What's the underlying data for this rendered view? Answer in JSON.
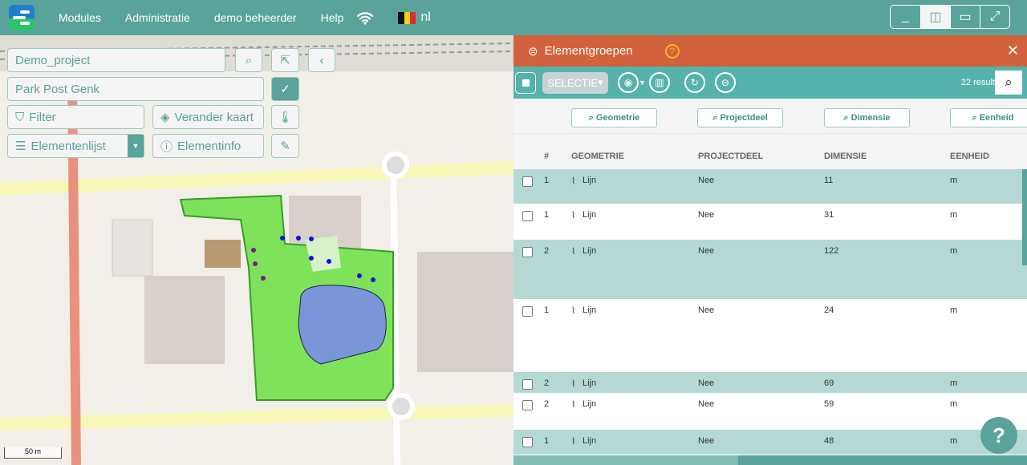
{
  "nav": {
    "items": [
      "Modules",
      "Administratie",
      "demo beheerder",
      "Help"
    ],
    "language": "nl"
  },
  "map": {
    "project": "Demo_project",
    "site": "Park Post Genk",
    "filter": "Filter",
    "change_map": "Verander kaart",
    "element_list": "Elementenlijst",
    "element_info": "Elementinfo",
    "scale": "50 m"
  },
  "panel": {
    "title": "Elementgroepen",
    "selection": "SELECTIE",
    "results": "22 result",
    "filters": [
      "Geometrie",
      "Projectdeel",
      "Dimensie",
      "Eenheid"
    ],
    "columns": [
      "#",
      "GEOMETRIE",
      "PROJECTDEEL",
      "DIMENSIE",
      "EENHEID"
    ],
    "rows": [
      {
        "n": "1",
        "geo": "Lijn",
        "deel": "Nee",
        "dim": "11",
        "unit": "m"
      },
      {
        "n": "1",
        "geo": "Lijn",
        "deel": "Nee",
        "dim": "31",
        "unit": "m"
      },
      {
        "n": "2",
        "geo": "Lijn",
        "deel": "Nee",
        "dim": "122",
        "unit": "m"
      },
      {
        "n": "1",
        "geo": "Lijn",
        "deel": "Nee",
        "dim": "24",
        "unit": "m"
      },
      {
        "n": "2",
        "geo": "Lijn",
        "deel": "Nee",
        "dim": "69",
        "unit": "m"
      },
      {
        "n": "2",
        "geo": "Lijn",
        "deel": "Nee",
        "dim": "59",
        "unit": "m"
      },
      {
        "n": "1",
        "geo": "Lijn",
        "deel": "Nee",
        "dim": "48",
        "unit": "m"
      }
    ]
  },
  "help": "?",
  "colors": {
    "header": "#5aa39a",
    "panel_header": "#d2623c",
    "toolbar": "#55b3ac",
    "row_teal": "#b4d9d5"
  }
}
